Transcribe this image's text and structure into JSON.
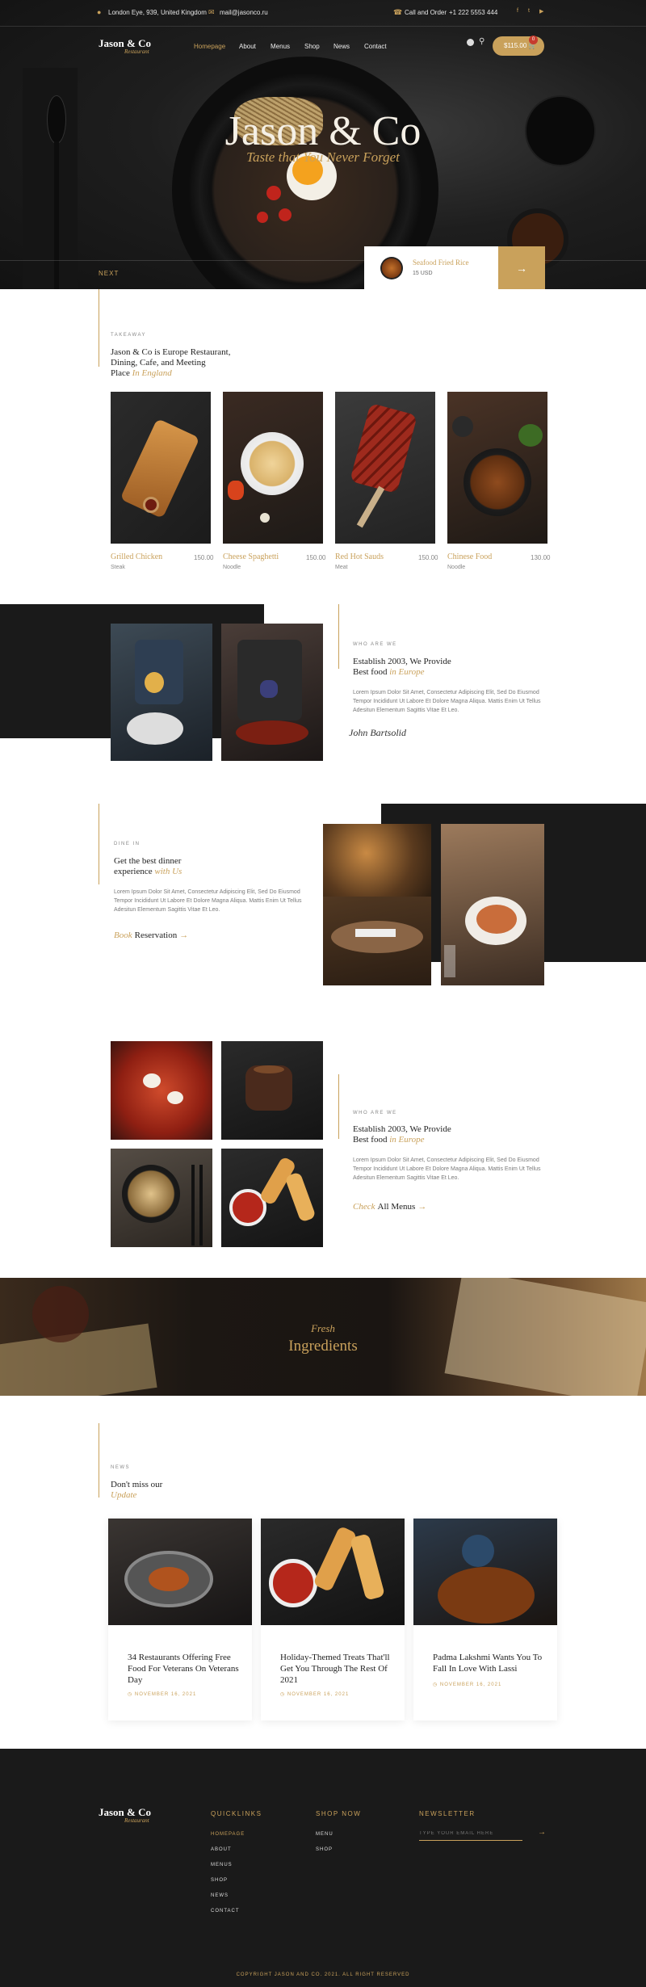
{
  "topbar": {
    "address": "London Eye, 939, United Kingdom",
    "email": "mail@jasonco.ru",
    "call_label": "Call and Order",
    "phone": "+1 222 5553 444"
  },
  "brand": {
    "name": "Jason & Co",
    "tagline": "Restaurant"
  },
  "nav": {
    "items": [
      "Homepage",
      "About",
      "Menus",
      "Shop",
      "News",
      "Contact"
    ],
    "active": "Homepage"
  },
  "cart": {
    "amount": "$115.00",
    "count": "0"
  },
  "hero": {
    "title": "Jason & Co",
    "subtitle": "Taste that You Never Forget",
    "next_label": "NEXT",
    "featured_name": "Seafood Fried Rice",
    "featured_price": "15 USD",
    "arrow": "→"
  },
  "takeaway": {
    "eyebrow": "TAKEAWAY",
    "heading_line1": "Jason & Co is Europe Restaurant,",
    "heading_line2": "Dining, Cafe, and Meeting",
    "heading_line3": "Place",
    "heading_accent": "In England",
    "items": [
      {
        "name": "Grilled Chicken",
        "price": "150.00",
        "category": "Steak"
      },
      {
        "name": "Cheese Spaghetti",
        "price": "150.00",
        "category": "Noodle"
      },
      {
        "name": "Red Hot Sauds",
        "price": "150.00",
        "category": "Meat"
      },
      {
        "name": "Chinese Food",
        "price": "130.00",
        "category": "Noodle"
      }
    ]
  },
  "about": {
    "eyebrow": "WHO ARE WE",
    "heading_line1": "Establish 2003, We Provide",
    "heading_line2": "Best food",
    "heading_accent": "in Europe",
    "text": "Lorem Ipsum Dolor Sit Amet, Consectetur Adipiscing Elit, Sed Do Eiusmod Tempor Incididunt Ut Labore Et Dolore Magna Aliqua. Mattis Enim Ut Tellus Adesitun Elementum Sagittis Vitae Et Leo.",
    "signature": "John Bartsolid"
  },
  "dinein": {
    "eyebrow": "DINE IN",
    "heading_line1": "Get the best dinner",
    "heading_line2": "experience",
    "heading_accent": "with Us",
    "text": "Lorem Ipsum Dolor Sit Amet, Consectetur Adipiscing Elit, Sed Do Eiusmod Tempor Incididunt Ut Labore Et Dolore Magna Aliqua. Mattis Enim Ut Tellus Adesitun Elementum Sagittis Vitae Et Leo.",
    "cta_accent": "Book",
    "cta_label": "Reservation",
    "arrow": "→"
  },
  "menus": {
    "eyebrow": "WHO ARE WE",
    "heading_line1": "Establish 2003, We Provide",
    "heading_line2": "Best food",
    "heading_accent": "in Europe",
    "text": "Lorem Ipsum Dolor Sit Amet, Consectetur Adipiscing Elit, Sed Do Eiusmod Tempor Incididunt Ut Labore Et Dolore Magna Aliqua. Mattis Enim Ut Tellus Adesitun Elementum Sagittis Vitae Et Leo.",
    "cta_accent": "Check",
    "cta_label": "All Menus",
    "arrow": "→"
  },
  "banner": {
    "accent": "Fresh",
    "title": "Ingredients"
  },
  "news": {
    "eyebrow": "NEWS",
    "heading": "Don't miss our",
    "heading_accent": "Update",
    "posts": [
      {
        "title": "34 Restaurants Offering Free Food For Veterans On Veterans Day",
        "date": "NOVEMBER 16, 2021"
      },
      {
        "title": "Holiday-Themed Treats That'll Get You Through The Rest Of 2021",
        "date": "NOVEMBER 16, 2021"
      },
      {
        "title": "Padma Lakshmi Wants You To Fall In Love With Lassi",
        "date": "NOVEMBER 16, 2021"
      }
    ]
  },
  "footer": {
    "quicklinks_title": "QUICKLINKS",
    "quicklinks": [
      "HOMEPAGE",
      "ABOUT",
      "MENUS",
      "SHOP",
      "NEWS",
      "CONTACT"
    ],
    "shop_title": "SHOP NOW",
    "shop_links": [
      "MENU",
      "SHOP"
    ],
    "newsletter_title": "NEWSLETTER",
    "newsletter_placeholder": "TYPE YOUR EMAIL HERE",
    "arrow": "→",
    "copyright": "COPYRIGHT JASON AND CO. 2021. ALL RIGHT RESERVED"
  },
  "colors": {
    "accent": "#c9a15b",
    "dark": "#1a1a1a",
    "badge": "#c63b2e"
  }
}
